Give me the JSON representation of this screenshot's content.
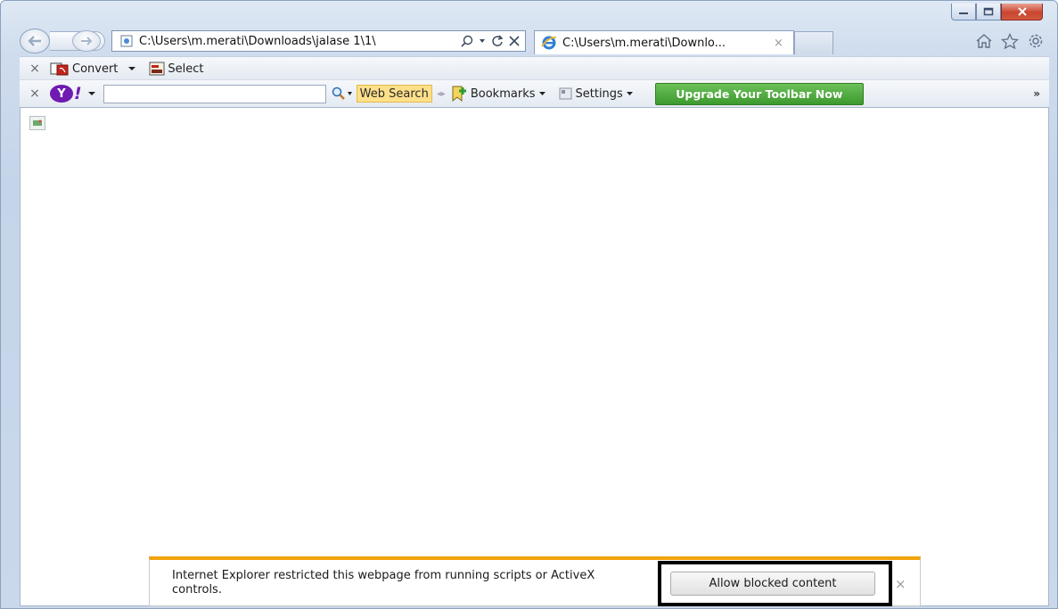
{
  "window": {
    "caption_buttons": [
      "minimize-icon",
      "maximize-icon",
      "close-icon"
    ]
  },
  "address_bar": {
    "url": "C:\\Users\\m.merati\\Downloads\\jalase 1\\1\\",
    "tools": [
      "search-icon",
      "dropdown-icon",
      "refresh-icon",
      "stop-icon"
    ]
  },
  "tab": {
    "title": "C:\\Users\\m.merati\\Downlo...",
    "close": "×"
  },
  "right_icons": [
    "home-icon",
    "favorites-star-icon",
    "tools-gear-icon"
  ],
  "toolbar1": {
    "close": "×",
    "convert_label": "Convert",
    "select_label": "Select"
  },
  "toolbar2": {
    "close": "×",
    "web_search_label": "Web Search",
    "bookmarks_label": "Bookmarks",
    "settings_label": "Settings",
    "upgrade_label": "Upgrade Your Toolbar Now",
    "more": "»"
  },
  "notification": {
    "message": "Internet Explorer restricted this webpage from running scripts or ActiveX controls.",
    "button_label": "Allow blocked content",
    "close": "×",
    "accent_color": "#f2a30a"
  }
}
